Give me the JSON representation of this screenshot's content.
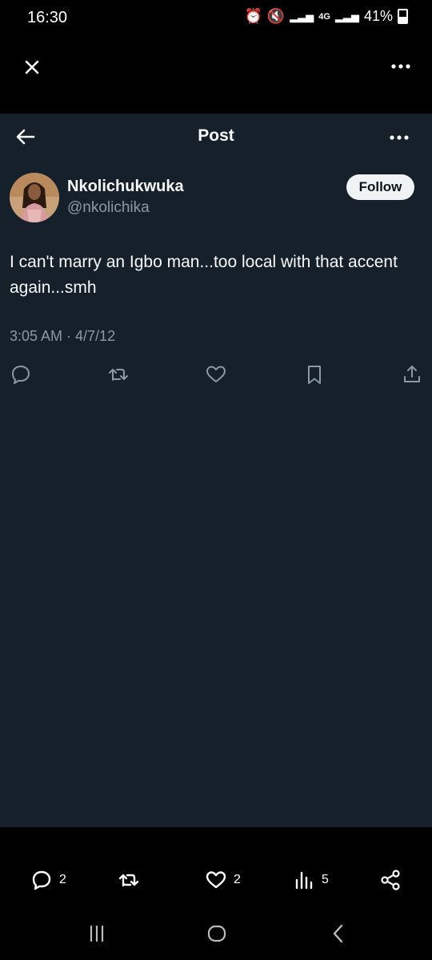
{
  "status_bar": {
    "time": "16:30",
    "battery": "41%",
    "network": "4G"
  },
  "header": {
    "title": "Post"
  },
  "author": {
    "display_name": "Nkolichukwuka",
    "handle": "@nkolichika",
    "follow_label": "Follow"
  },
  "tweet": {
    "text": "I can't marry an Igbo man...too local with that accent again...smh",
    "timestamp": "3:05 AM · 4/7/12"
  },
  "media_actions": {
    "replies": "2",
    "likes": "2",
    "views": "5"
  },
  "colors": {
    "background": "#15202b",
    "muted": "#8b98a5",
    "follow_bg": "#eff3f4"
  },
  "icons": [
    "close-icon",
    "more-icon",
    "back-arrow-icon",
    "reply-icon",
    "retweet-icon",
    "like-icon",
    "bookmark-icon",
    "share-icon",
    "views-icon",
    "share-nodes-icon",
    "recent-apps-icon",
    "home-icon",
    "back-nav-icon"
  ]
}
